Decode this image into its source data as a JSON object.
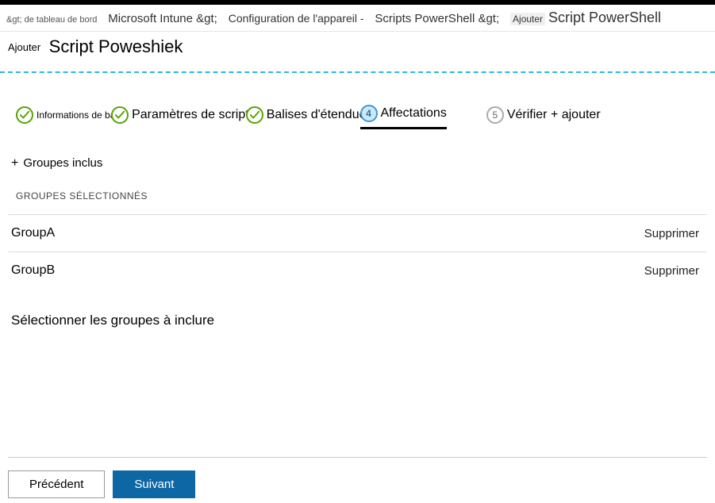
{
  "breadcrumb": {
    "item1": "&gt; de tableau de bord",
    "item2": "Microsoft Intune &gt;",
    "item3": "Configuration de l'appareil -",
    "item4": "Scripts PowerShell &gt;",
    "item5_small": "Ajouter",
    "item5_big": "Script PowerShell"
  },
  "header": {
    "label": "Ajouter",
    "title": "Script Poweshiek"
  },
  "steps": {
    "s1": {
      "label": "Informations de base"
    },
    "s2": {
      "label": "Paramètres de script"
    },
    "s3": {
      "label": "Balises d'étendue"
    },
    "s4": {
      "num": "4",
      "label": "Affectations"
    },
    "s5": {
      "num": "5",
      "label": "Vérifier + ajouter"
    }
  },
  "included": {
    "toggle": "Groupes inclus",
    "subheader": "GROUPES SÉLECTIONNÉS",
    "rows": [
      {
        "name": "GroupA",
        "remove": "Supprimer"
      },
      {
        "name": "GroupB",
        "remove": "Supprimer"
      }
    ],
    "select_prompt": "Sélectionner les groupes à inclure"
  },
  "footer": {
    "back": "Précédent",
    "next": "Suivant"
  }
}
